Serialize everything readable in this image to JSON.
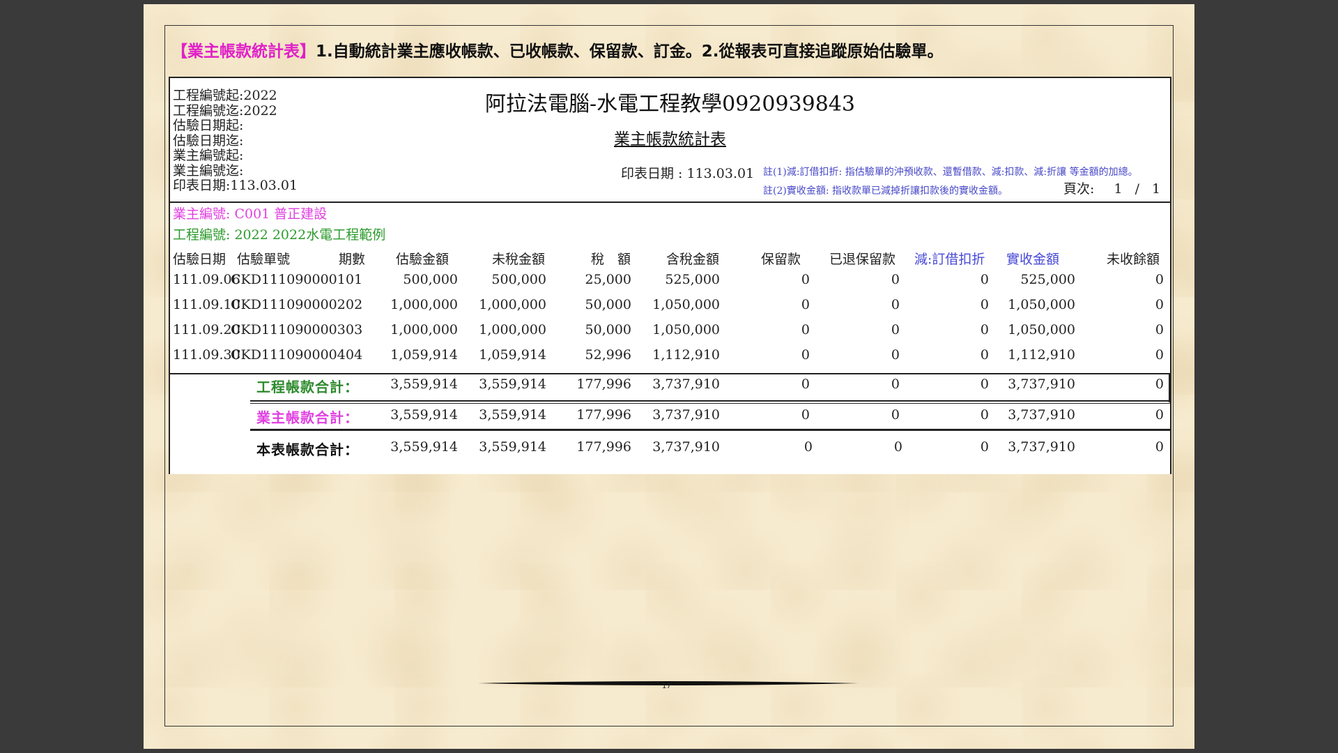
{
  "headline": {
    "tag": "【業主帳款統計表】",
    "text": "1.自動統計業主應收帳款、已收帳款、保留款、訂金。2.從報表可直接追蹤原始估驗單。"
  },
  "report": {
    "params": [
      "工程編號起:2022",
      "工程編號迄:2022",
      "估驗日期起:",
      "估驗日期迄:",
      "業主編號起:",
      "業主編號迄:",
      "印表日期:113.03.01"
    ],
    "company": "阿拉法電腦-水電工程教學0920939843",
    "title": "業主帳款統計表",
    "print_date": "印表日期 : 113.03.01",
    "notes": [
      "註(1)減:訂借扣折: 指估驗單的沖預收款、還暫借款、減:扣款、減:折讓 等金額的加總。",
      "註(2)實收金額: 指收款單已減掉折讓扣款後的實收金額。"
    ],
    "page_label": "頁次:",
    "page_current": "1",
    "page_sep": "/",
    "page_total": "1",
    "owner_line": "業主編號: C001 普正建設",
    "project_line": "工程編號: 2022 2022水電工程範例",
    "columns": [
      "估驗日期",
      "估驗單號",
      "期數",
      "估驗金額",
      "未稅金額",
      "稅　額",
      "含稅金額",
      "保留款",
      "已退保留款",
      "減:訂借扣折",
      "實收金額",
      "未收餘額"
    ],
    "rows": [
      [
        "111.09.06",
        "CKD1110900001",
        "01",
        "500,000",
        "500,000",
        "25,000",
        "525,000",
        "0",
        "0",
        "0",
        "525,000",
        "0"
      ],
      [
        "111.09.10",
        "CKD1110900002",
        "02",
        "1,000,000",
        "1,000,000",
        "50,000",
        "1,050,000",
        "0",
        "0",
        "0",
        "1,050,000",
        "0"
      ],
      [
        "111.09.20",
        "CKD1110900003",
        "03",
        "1,000,000",
        "1,000,000",
        "50,000",
        "1,050,000",
        "0",
        "0",
        "0",
        "1,050,000",
        "0"
      ],
      [
        "111.09.30",
        "CKD1110900004",
        "04",
        "1,059,914",
        "1,059,914",
        "52,996",
        "1,112,910",
        "0",
        "0",
        "0",
        "1,112,910",
        "0"
      ]
    ],
    "totals": [
      {
        "label": "工程帳款合計：",
        "values": [
          "3,559,914",
          "3,559,914",
          "177,996",
          "3,737,910",
          "0",
          "0",
          "0",
          "3,737,910",
          "0"
        ]
      },
      {
        "label": "業主帳款合計：",
        "values": [
          "3,559,914",
          "3,559,914",
          "177,996",
          "3,737,910",
          "0",
          "0",
          "0",
          "3,737,910",
          "0"
        ]
      },
      {
        "label": "本表帳款合計：",
        "values": [
          "3,559,914",
          "3,559,914",
          "177,996",
          "3,737,910",
          "0",
          "0",
          "0",
          "3,737,910",
          "0"
        ]
      }
    ]
  },
  "page_number": "17",
  "colors": {
    "tag": "#e020c8",
    "owner": "#e040e0",
    "project": "#2c9a2c",
    "blue_header": "#4848d8",
    "background": "#f7ebcf"
  }
}
